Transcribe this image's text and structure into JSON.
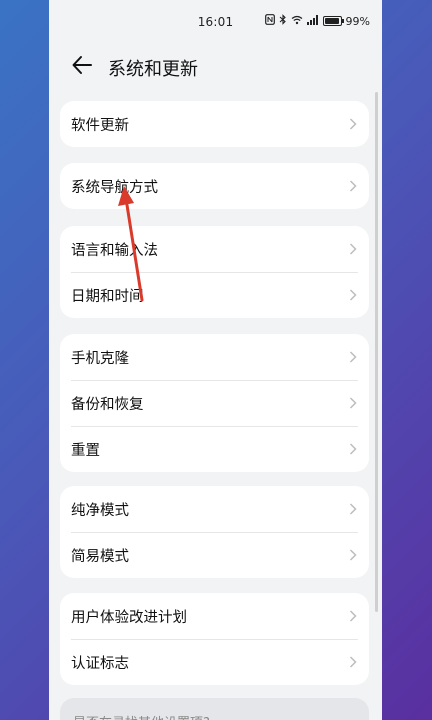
{
  "status": {
    "time": "16:01",
    "battery_text": "99%",
    "icons": [
      "nfc-icon",
      "bluetooth-icon",
      "wifi-icon",
      "signal-icon",
      "battery-icon"
    ]
  },
  "header": {
    "title": "系统和更新"
  },
  "groups": [
    {
      "items": [
        {
          "label": "软件更新"
        }
      ]
    },
    {
      "items": [
        {
          "label": "系统导航方式"
        }
      ]
    },
    {
      "items": [
        {
          "label": "语言和输入法"
        },
        {
          "label": "日期和时间"
        }
      ]
    },
    {
      "items": [
        {
          "label": "手机克隆"
        },
        {
          "label": "备份和恢复"
        },
        {
          "label": "重置"
        }
      ]
    },
    {
      "items": [
        {
          "label": "纯净模式"
        },
        {
          "label": "简易模式"
        }
      ]
    },
    {
      "items": [
        {
          "label": "用户体验改进计划"
        },
        {
          "label": "认证标志"
        }
      ]
    }
  ],
  "hint": {
    "text": "是否在寻找其他设置项?"
  },
  "colors": {
    "background_start": "#3a73c4",
    "background_end": "#5a2fa0",
    "annotation": "#d93a2b"
  }
}
